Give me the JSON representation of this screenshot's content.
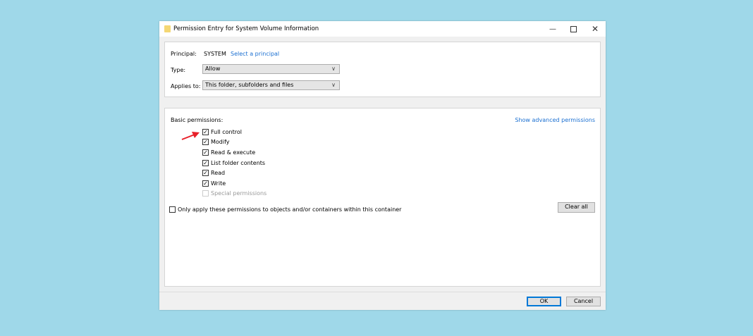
{
  "window": {
    "title": "Permission Entry for System Volume Information",
    "controls": [
      "minimize",
      "maximize",
      "close"
    ]
  },
  "principal": {
    "label": "Principal:",
    "value": "SYSTEM",
    "link": "Select a principal"
  },
  "type": {
    "label": "Type:",
    "value": "Allow"
  },
  "applies_to": {
    "label": "Applies to:",
    "value": "This folder, subfolders and files"
  },
  "permissions": {
    "heading": "Basic permissions:",
    "advanced_link": "Show advanced permissions",
    "items": [
      {
        "label": "Full control",
        "checked": true,
        "enabled": true
      },
      {
        "label": "Modify",
        "checked": true,
        "enabled": true
      },
      {
        "label": "Read & execute",
        "checked": true,
        "enabled": true
      },
      {
        "label": "List folder contents",
        "checked": true,
        "enabled": true
      },
      {
        "label": "Read",
        "checked": true,
        "enabled": true
      },
      {
        "label": "Write",
        "checked": true,
        "enabled": true
      },
      {
        "label": "Special permissions",
        "checked": false,
        "enabled": false
      }
    ],
    "only_apply": {
      "label": "Only apply these permissions to objects and/or containers within this container",
      "checked": false
    },
    "clear_all": "Clear all"
  },
  "footer": {
    "ok": "OK",
    "cancel": "Cancel"
  },
  "annotation": {
    "arrow_color": "#e8202a"
  }
}
